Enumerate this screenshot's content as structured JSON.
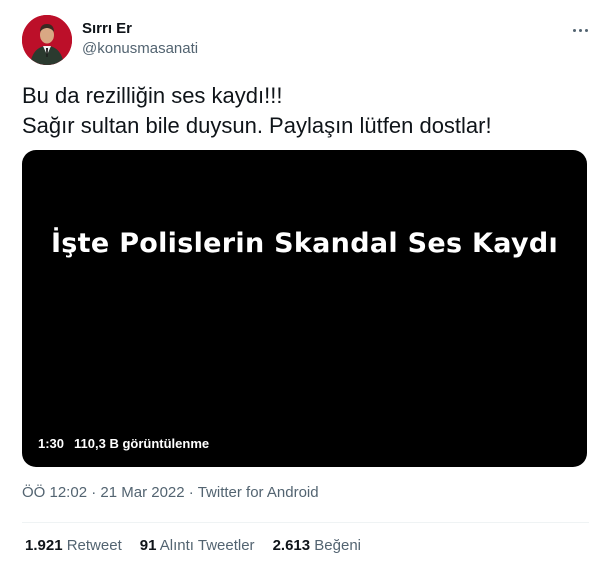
{
  "author": {
    "display_name": "Sırrı Er",
    "handle": "@konusmasanati"
  },
  "tweet": {
    "line1": "Bu da rezilliğin ses kaydı!!!",
    "line2": "Sağır sultan bile duysun. Paylaşın lütfen dostlar!"
  },
  "media": {
    "overlay_title": "İşte Polislerin Skandal Ses Kaydı",
    "duration": "1:30",
    "views": "110,3 B görüntülenme"
  },
  "meta": {
    "time": "ÖÖ 12:02",
    "separator": "·",
    "date": "21 Mar 2022",
    "source": "Twitter for Android"
  },
  "stats": {
    "retweets_count": "1.921",
    "retweets_label": "Retweet",
    "quotes_count": "91",
    "quotes_label": "Alıntı Tweetler",
    "likes_count": "2.613",
    "likes_label": "Beğeni"
  },
  "icons": {
    "more": "more-horizontal-icon"
  },
  "colors": {
    "avatar_background": "#c8102e",
    "secondary_text": "#536471",
    "media_background": "#000000"
  }
}
